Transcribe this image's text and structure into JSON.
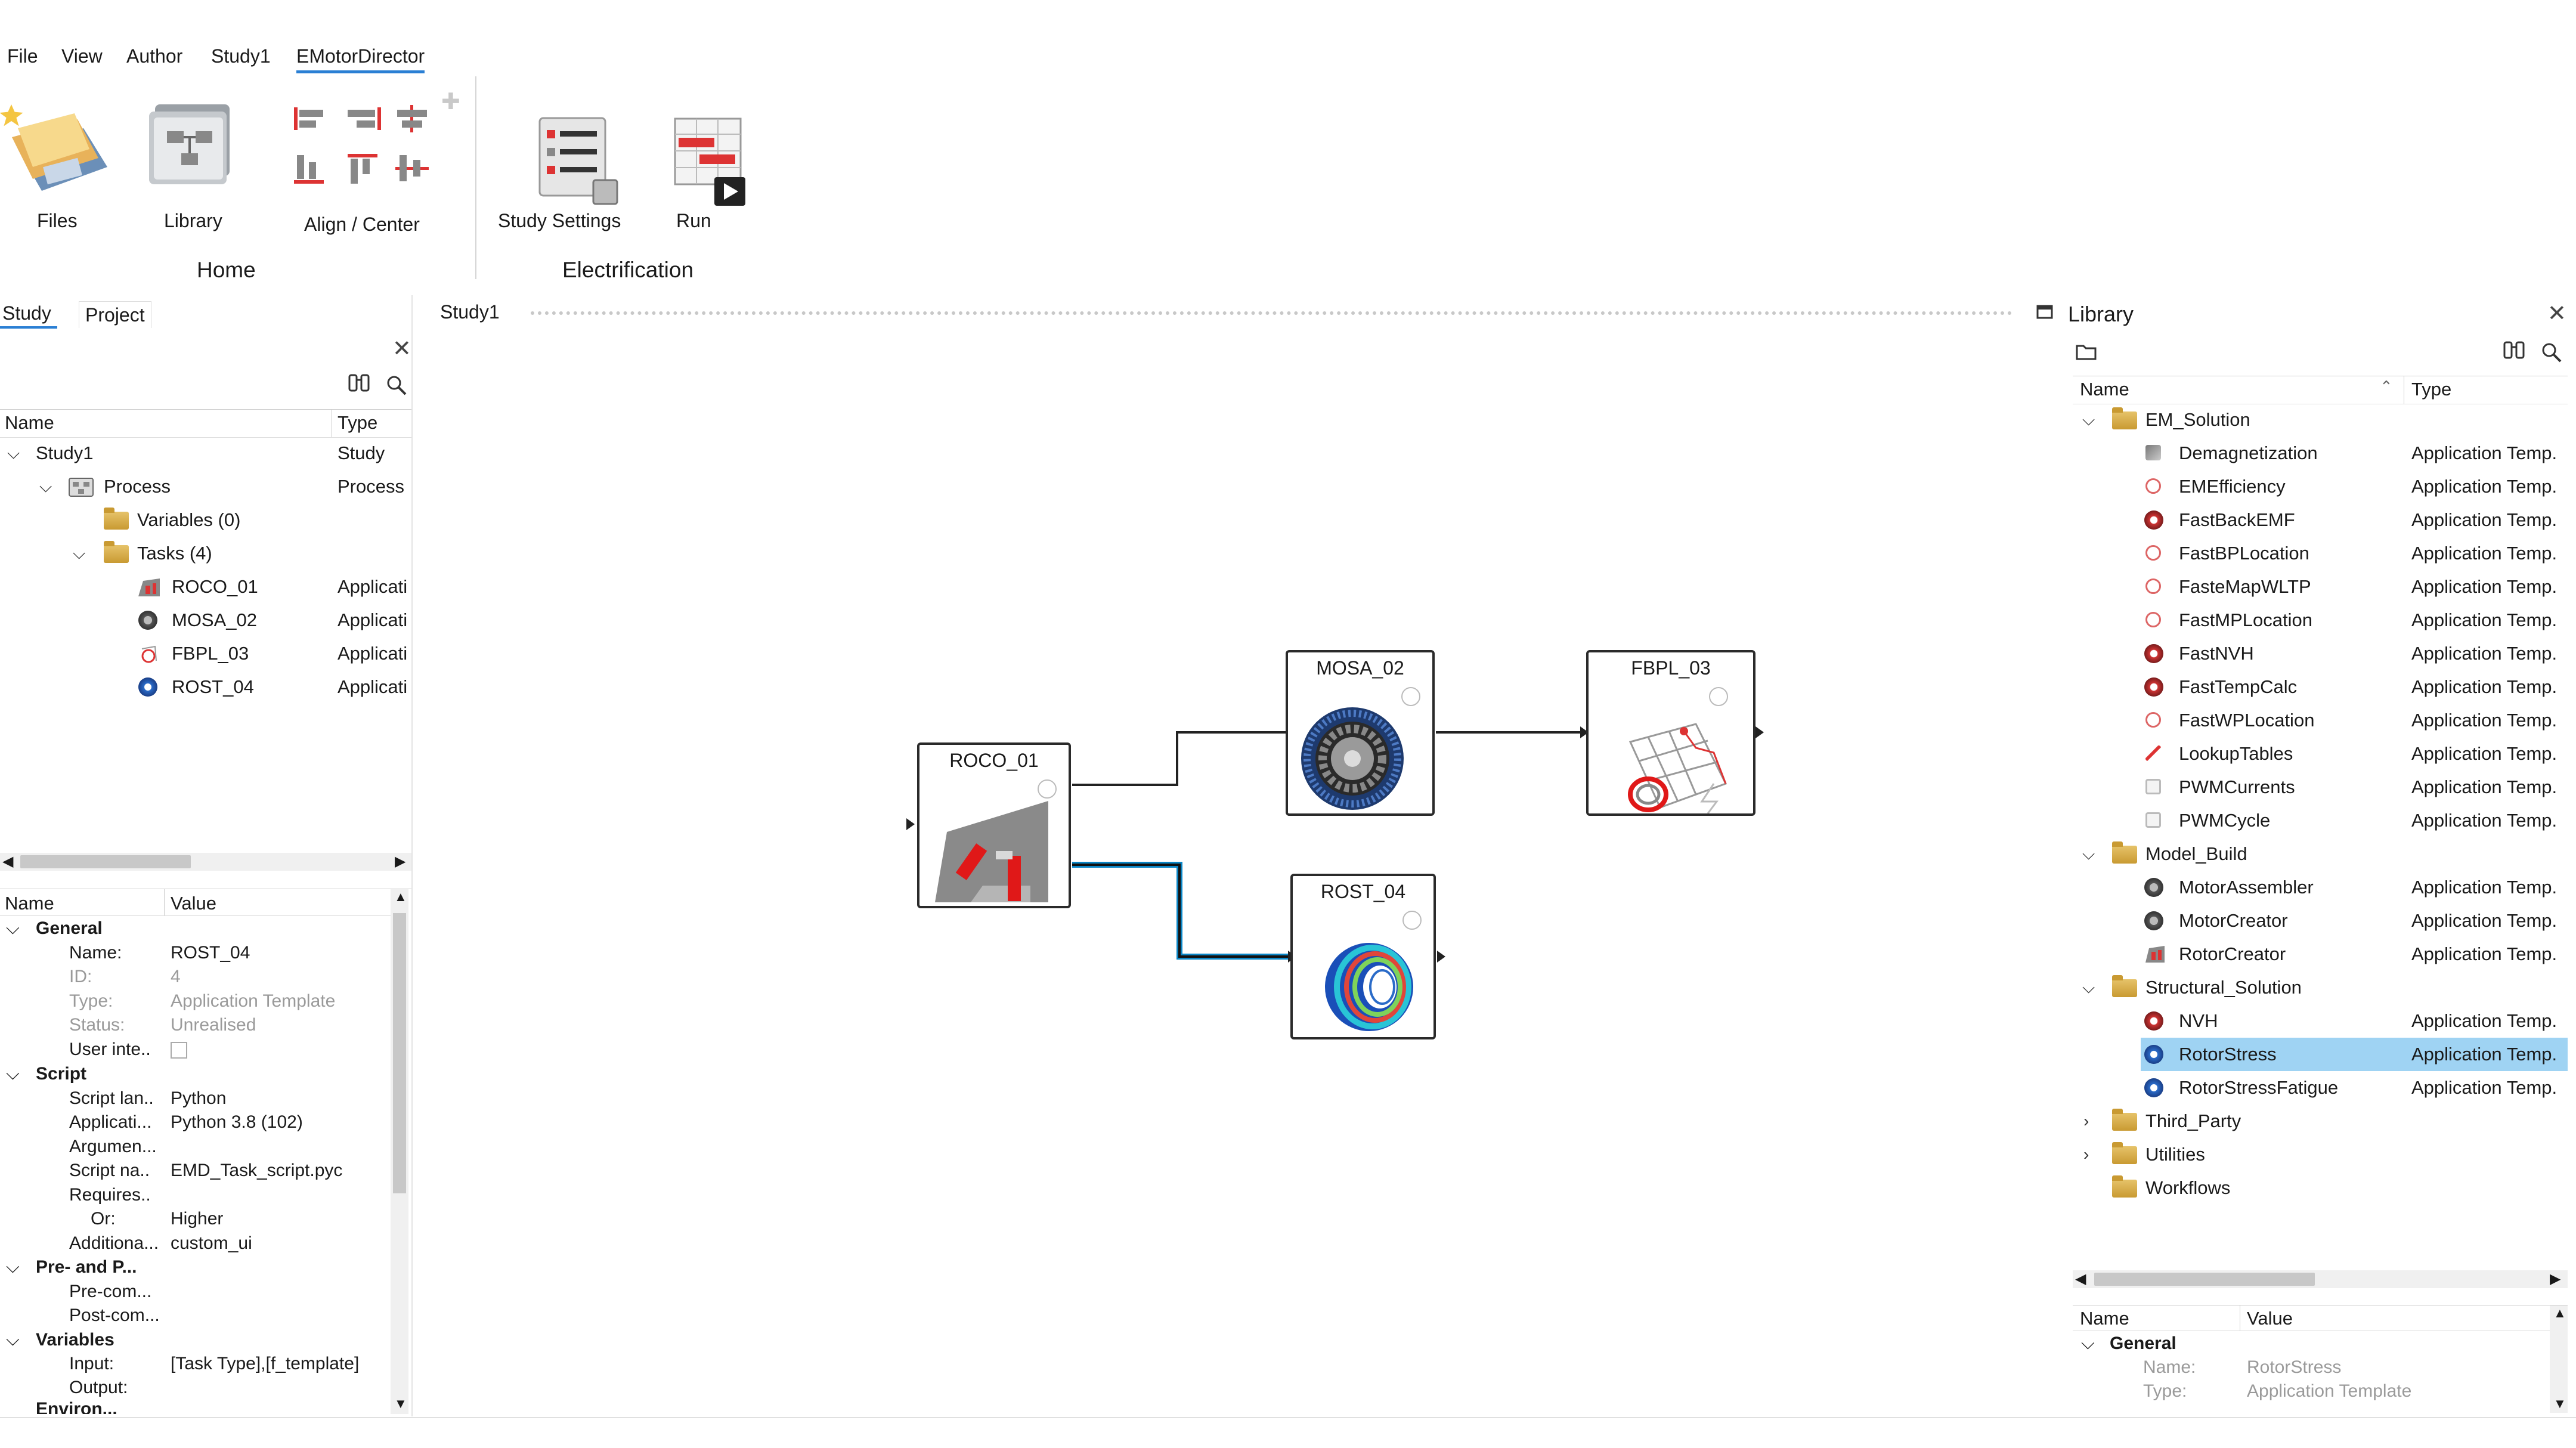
{
  "menu": {
    "items": [
      "File",
      "View",
      "Author",
      "Study1",
      "EMotorDirector"
    ],
    "active_index": 4
  },
  "ribbon": {
    "files_label": "Files",
    "library_label": "Library",
    "align_label": "Align / Center",
    "home_group": "Home",
    "study_settings_label": "Study Settings",
    "run_label": "Run",
    "electrification_group": "Electrification"
  },
  "left_panel": {
    "tabs": [
      "Study",
      "Project"
    ],
    "active_tab": "Study",
    "tree_headers": {
      "name": "Name",
      "type": "Type"
    },
    "tree": [
      {
        "label": "Study1",
        "type": "Study",
        "icon": "none",
        "expanded": true
      },
      {
        "label": "Process",
        "type": "Process",
        "icon": "process-icon",
        "expanded": true
      },
      {
        "label": "Variables (0)",
        "type": "",
        "icon": "folder-icon"
      },
      {
        "label": "Tasks (4)",
        "type": "",
        "icon": "folder-icon",
        "expanded": true
      },
      {
        "label": "ROCO_01",
        "type": "Applicati",
        "icon": "rotor-creator-icon"
      },
      {
        "label": "MOSA_02",
        "type": "Applicati",
        "icon": "motor-assembler-icon"
      },
      {
        "label": "FBPL_03",
        "type": "Applicati",
        "icon": "fbpl-icon"
      },
      {
        "label": "ROST_04",
        "type": "Applicati",
        "icon": "rotor-stress-icon"
      }
    ]
  },
  "properties": {
    "headers": {
      "name": "Name",
      "value": "Value"
    },
    "sections": {
      "general": "General",
      "script": "Script",
      "pre_post": "Pre- and P...",
      "variables": "Variables",
      "trailing": "Environ..."
    },
    "rows": {
      "name": {
        "key": "Name:",
        "value": "ROST_04"
      },
      "id": {
        "key": "ID:",
        "value": "4"
      },
      "type": {
        "key": "Type:",
        "value": "Application Template"
      },
      "status": {
        "key": "Status:",
        "value": "Unrealised"
      },
      "user_inte": {
        "key": "User inte..",
        "value": ""
      },
      "script_lang": {
        "key": "Script lan..",
        "value": "Python"
      },
      "applicati": {
        "key": "Applicati...",
        "value": "Python 3.8 (102)"
      },
      "argumen": {
        "key": "Argumen...",
        "value": ""
      },
      "script_name": {
        "key": "Script na..",
        "value": "EMD_Task_script.pyc"
      },
      "requires": {
        "key": "Requires..",
        "value": ""
      },
      "or": {
        "key": "Or:",
        "value": "Higher"
      },
      "additiona": {
        "key": "Additiona...",
        "value": "custom_ui"
      },
      "pre_com": {
        "key": "Pre-com...",
        "value": ""
      },
      "post_com": {
        "key": "Post-com...",
        "value": ""
      },
      "input": {
        "key": "Input:",
        "value": "[Task Type],[f_template]"
      },
      "output": {
        "key": "Output:",
        "value": ""
      }
    }
  },
  "canvas": {
    "tab": "Study1",
    "nodes": {
      "roco": "ROCO_01",
      "mosa": "MOSA_02",
      "fbpl": "FBPL_03",
      "rost": "ROST_04"
    }
  },
  "library": {
    "title": "Library",
    "headers": {
      "name": "Name",
      "type": "Type"
    },
    "items": [
      {
        "label": "EM_Solution",
        "type": "",
        "kind": "folder",
        "expanded": true
      },
      {
        "label": "Demagnetization",
        "type": "Application Temp.",
        "kind": "item",
        "icon": "demag-icon"
      },
      {
        "label": "EMEfficiency",
        "type": "Application Temp.",
        "kind": "item",
        "icon": "efficiency-icon"
      },
      {
        "label": "FastBackEMF",
        "type": "Application Temp.",
        "kind": "item",
        "icon": "backemf-icon"
      },
      {
        "label": "FastBPLocation",
        "type": "Application Temp.",
        "kind": "item",
        "icon": "bplocation-icon"
      },
      {
        "label": "FasteMapWLTP",
        "type": "Application Temp.",
        "kind": "item",
        "icon": "emap-icon"
      },
      {
        "label": "FastMPLocation",
        "type": "Application Temp.",
        "kind": "item",
        "icon": "mplocation-icon"
      },
      {
        "label": "FastNVH",
        "type": "Application Temp.",
        "kind": "item",
        "icon": "nvh-icon"
      },
      {
        "label": "FastTempCalc",
        "type": "Application Temp.",
        "kind": "item",
        "icon": "tempcalc-icon"
      },
      {
        "label": "FastWPLocation",
        "type": "Application Temp.",
        "kind": "item",
        "icon": "wplocation-icon"
      },
      {
        "label": "LookupTables",
        "type": "Application Temp.",
        "kind": "item",
        "icon": "lookup-icon"
      },
      {
        "label": "PWMCurrents",
        "type": "Application Temp.",
        "kind": "item",
        "icon": "pwm-currents-icon"
      },
      {
        "label": "PWMCycle",
        "type": "Application Temp.",
        "kind": "item",
        "icon": "pwm-cycle-icon"
      },
      {
        "label": "Model_Build",
        "type": "",
        "kind": "folder",
        "expanded": true
      },
      {
        "label": "MotorAssembler",
        "type": "Application Temp.",
        "kind": "item",
        "icon": "motor-assembler-icon"
      },
      {
        "label": "MotorCreator",
        "type": "Application Temp.",
        "kind": "item",
        "icon": "motor-creator-icon"
      },
      {
        "label": "RotorCreator",
        "type": "Application Temp.",
        "kind": "item",
        "icon": "rotor-creator-icon"
      },
      {
        "label": "Structural_Solution",
        "type": "",
        "kind": "folder",
        "expanded": true
      },
      {
        "label": "NVH",
        "type": "Application Temp.",
        "kind": "item",
        "icon": "nvh-icon"
      },
      {
        "label": "RotorStress",
        "type": "Application Temp.",
        "kind": "item",
        "icon": "rotor-stress-icon",
        "selected": true
      },
      {
        "label": "RotorStressFatigue",
        "type": "Application Temp.",
        "kind": "item",
        "icon": "rotor-fatigue-icon"
      },
      {
        "label": "Third_Party",
        "type": "",
        "kind": "folder",
        "expanded": false
      },
      {
        "label": "Utilities",
        "type": "",
        "kind": "folder",
        "expanded": false
      },
      {
        "label": "Workflows",
        "type": "",
        "kind": "folder",
        "leaf": true
      }
    ],
    "props": {
      "headers": {
        "name": "Name",
        "value": "Value"
      },
      "section": "General",
      "name": {
        "key": "Name:",
        "value": "RotorStress"
      },
      "type": {
        "key": "Type:",
        "value": "Application Template"
      }
    }
  }
}
